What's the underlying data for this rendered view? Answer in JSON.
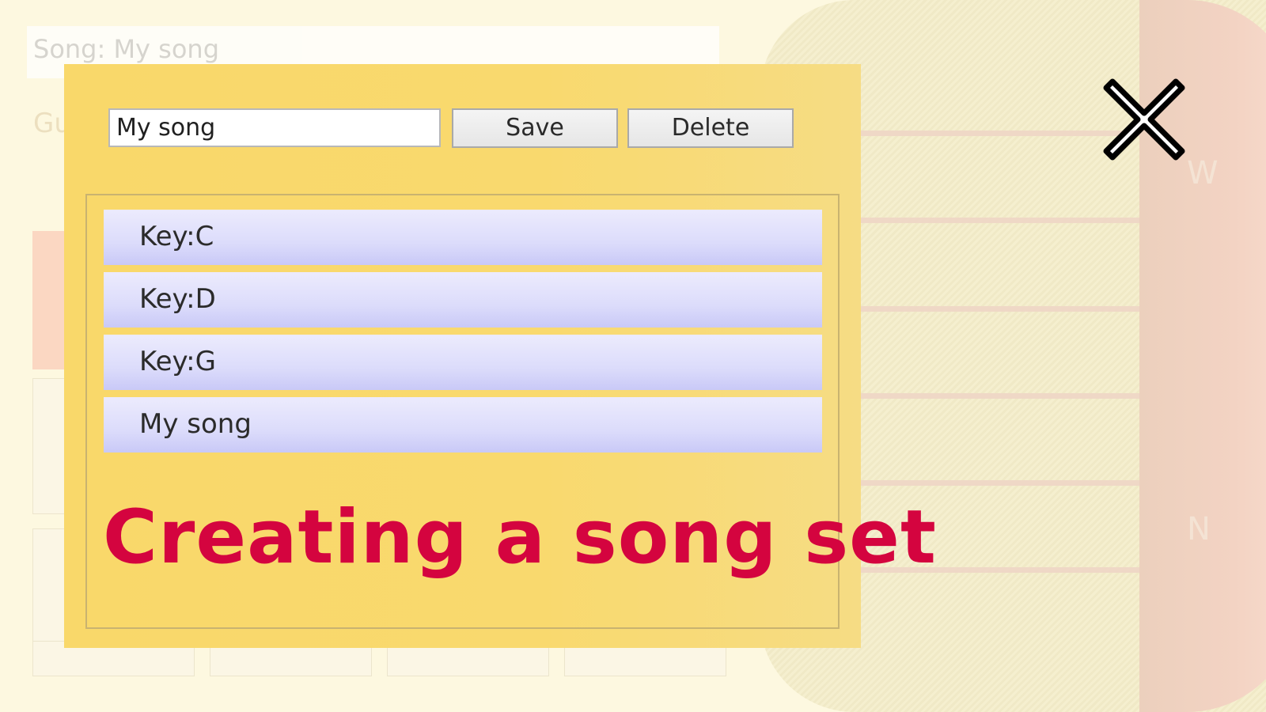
{
  "background": {
    "song_bar_text": "Song: My song",
    "guitar_label": "Gu",
    "side_letters": [
      "W",
      "N"
    ]
  },
  "dialog": {
    "name_input_value": "My song",
    "save_label": "Save",
    "delete_label": "Delete",
    "song_list": [
      {
        "label": "Key:C"
      },
      {
        "label": "Key:D"
      },
      {
        "label": "Key:G"
      },
      {
        "label": "My song"
      }
    ]
  },
  "headline": "Creating a song set",
  "close_icon": "close-x-icon",
  "colors": {
    "dialog_bg": "#f9d86a",
    "list_item": "#dcdcfb",
    "headline": "#d4043f"
  }
}
